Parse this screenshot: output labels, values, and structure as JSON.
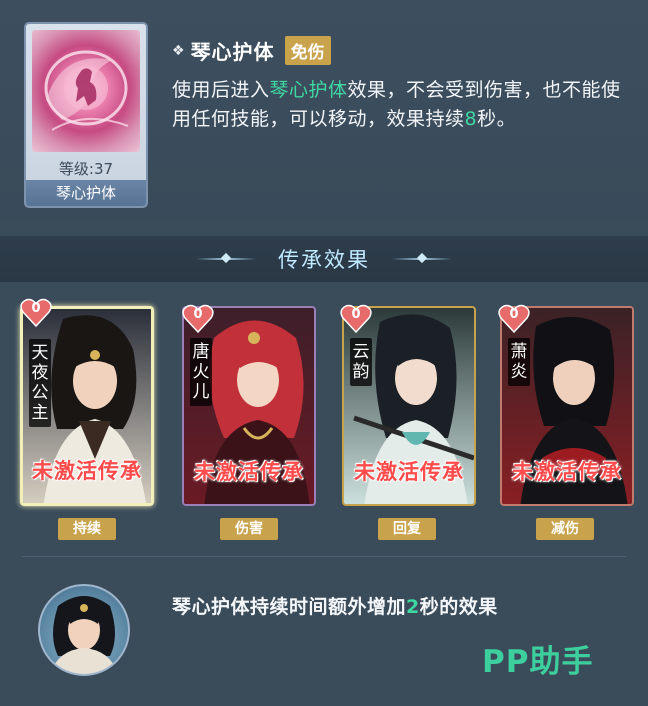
{
  "skill": {
    "level_text": "等级:37",
    "card_name": "琴心护体",
    "title": "琴心护体",
    "tag": "免伤",
    "desc_part1": "使用后进入",
    "desc_highlight": "琴心护体",
    "desc_part2": "效果，不会受到伤害，也不能使用任何技能，可以移动，效果持续",
    "desc_duration": "8",
    "desc_part3": "秒。"
  },
  "section": {
    "title": "传承效果"
  },
  "heroes": [
    {
      "name": "天夜公主",
      "count": "0",
      "status": "未激活传承",
      "tag": "持续"
    },
    {
      "name": "唐火儿",
      "count": "0",
      "status": "未激活传承",
      "tag": "伤害"
    },
    {
      "name": "云韵",
      "count": "0",
      "status": "未激活传承",
      "tag": "回复"
    },
    {
      "name": "萧炎",
      "count": "0",
      "status": "未激活传承",
      "tag": "减伤"
    }
  ],
  "bonus": {
    "part1": "琴心护体持续时间额外增加",
    "value": "2",
    "part2": "秒的效果"
  },
  "watermark": "PP助手",
  "colors": {
    "highlight": "#3fd7a2",
    "tag_gold": "#c9a24c",
    "inactive_red": "#ff4b4b",
    "heart_pink": "#e86b6b",
    "selected_border": "#f2f0b8"
  },
  "icons": {
    "title_icon": "diamond-bullet-icon",
    "count_icon": "heart-icon"
  }
}
